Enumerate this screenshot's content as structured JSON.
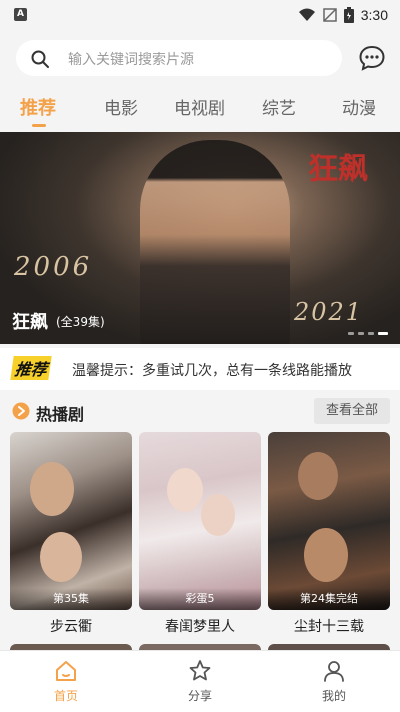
{
  "status_bar": {
    "time": "3:30",
    "app_indicator": "A"
  },
  "search": {
    "placeholder": "输入关键词搜索片源"
  },
  "tabs": [
    {
      "label": "推荐",
      "active": true
    },
    {
      "label": "电影",
      "active": false
    },
    {
      "label": "电视剧",
      "active": false
    },
    {
      "label": "综艺",
      "active": false
    },
    {
      "label": "动漫",
      "active": false
    }
  ],
  "banner": {
    "logo": "狂飙",
    "year_left": "2006",
    "year_right": "2021",
    "title": "狂飙",
    "episodes": "(全39集)",
    "slide_count": 4,
    "active_slide": 4
  },
  "notice": {
    "badge": "推荐",
    "text": "温馨提示：多重试几次，总有一条线路能播放"
  },
  "section": {
    "title": "热播剧",
    "view_all": "查看全部"
  },
  "cards": [
    {
      "title": "步云衢",
      "episodes": "第35集"
    },
    {
      "title": "春闺梦里人",
      "episodes": "彩蛋5"
    },
    {
      "title": "尘封十三载",
      "episodes": "第24集完结"
    }
  ],
  "bottom_nav": [
    {
      "label": "首页",
      "active": true,
      "icon": "home-icon"
    },
    {
      "label": "分享",
      "active": false,
      "icon": "star-share-icon"
    },
    {
      "label": "我的",
      "active": false,
      "icon": "user-icon"
    }
  ],
  "colors": {
    "accent": "#f4a24a",
    "notice_badge": "#f7d12a"
  }
}
